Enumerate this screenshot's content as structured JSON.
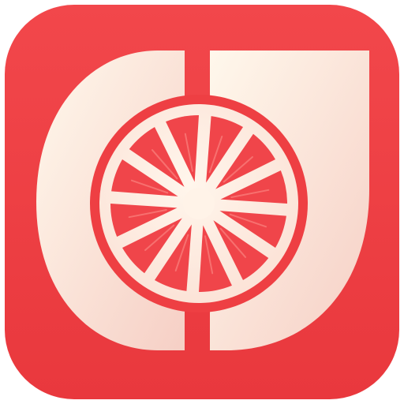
{
  "app_icon": {
    "icon": "citrus-slice-icon",
    "colors": {
      "background_top": "#F2474B",
      "background_bottom": "#E9383D",
      "cream_light": "#FFF8EC",
      "cream_shadow": "#F6CFC5",
      "ring": "#EE3F43",
      "segment": "#F0454A",
      "pith": "#FFF1E4"
    },
    "segment_count": 12
  }
}
